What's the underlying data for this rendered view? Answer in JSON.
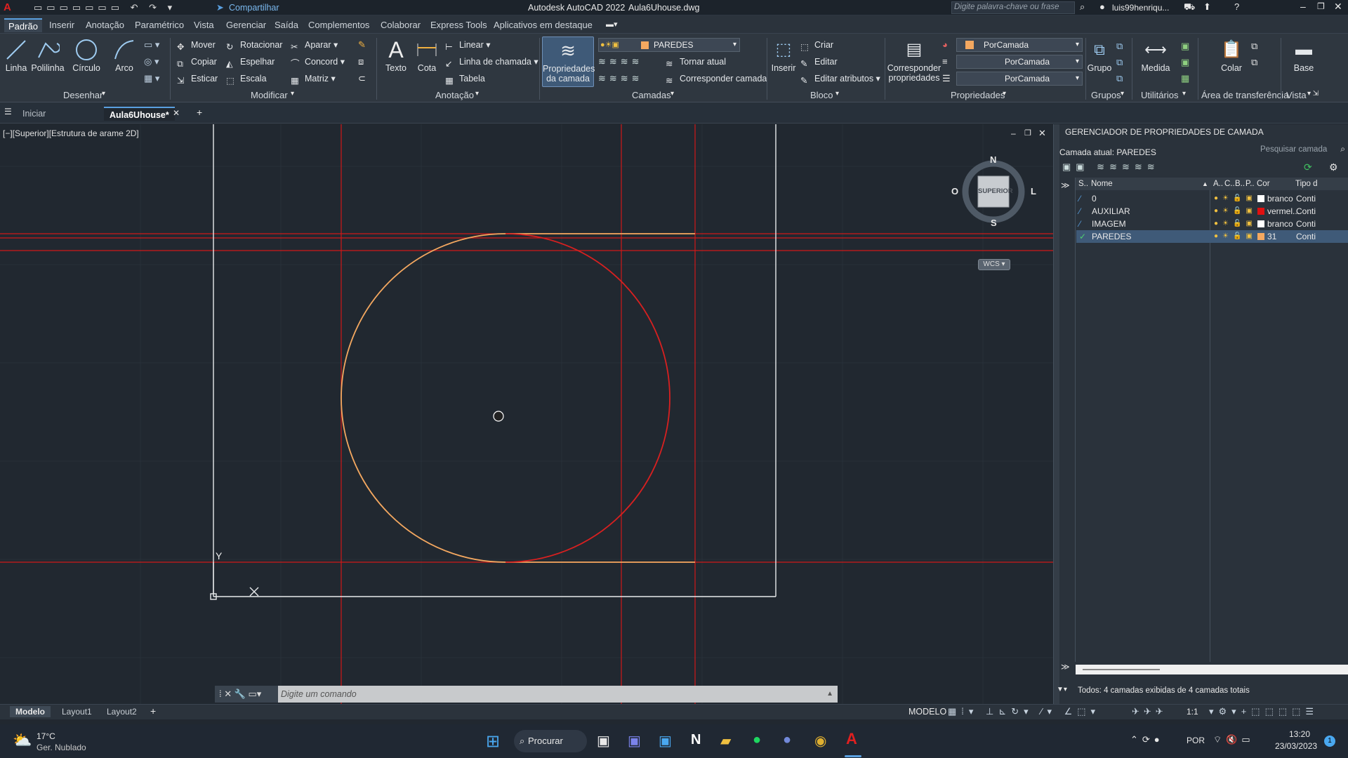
{
  "titlebar": {
    "app_title": "Autodesk AutoCAD 2022",
    "file_name": "Aula6Uhouse.dwg",
    "share_label": "Compartilhar",
    "search_placeholder": "Digite palavra-chave ou frase",
    "user": "luis99henriqu..."
  },
  "ribbon_tabs": [
    "Padrão",
    "Inserir",
    "Anotação",
    "Paramétrico",
    "Vista",
    "Gerenciar",
    "Saída",
    "Complementos",
    "Colaborar",
    "Express Tools",
    "Aplicativos em destaque"
  ],
  "ribbon": {
    "draw": {
      "title": "Desenhar",
      "linha": "Linha",
      "polilinha": "Polilinha",
      "circulo": "Círculo",
      "arco": "Arco"
    },
    "modify": {
      "title": "Modificar",
      "mover": "Mover",
      "rotacionar": "Rotacionar",
      "aparar": "Aparar",
      "copiar": "Copiar",
      "espelhar": "Espelhar",
      "concord": "Concord",
      "esticar": "Esticar",
      "escala": "Escala",
      "matriz": "Matriz"
    },
    "annotation": {
      "title": "Anotação",
      "texto": "Texto",
      "cota": "Cota",
      "linear": "Linear",
      "linha_chamada": "Linha de chamada",
      "tabela": "Tabela"
    },
    "layers": {
      "title": "Camadas",
      "props_line1": "Propriedades",
      "props_line2": "da camada",
      "current_layer": "PAREDES",
      "tornar_atual": "Tornar atual",
      "corresponder_camada": "Corresponder camada"
    },
    "block": {
      "title": "Bloco",
      "inserir": "Inserir",
      "criar": "Criar",
      "editar": "Editar",
      "editar_atributos": "Editar atributos"
    },
    "properties": {
      "title": "Propriedades",
      "corresp_line1": "Corresponder",
      "corresp_line2": "propriedades",
      "color": "PorCamada",
      "linetype": "PorCamada",
      "lineweight": "PorCamada"
    },
    "groups": {
      "title": "Grupos",
      "grupo": "Grupo"
    },
    "utilities": {
      "title": "Utilitários",
      "medida": "Medida"
    },
    "clipboard": {
      "title": "Área de transferência",
      "colar": "Colar"
    },
    "view": {
      "title": "Vista",
      "base": "Base"
    }
  },
  "doc_tabs": {
    "start": "Iniciar",
    "active": "Aula6Uhouse*"
  },
  "viewport": {
    "label": "[−][Superior][Estrutura de arame 2D]",
    "viewcube": {
      "n": "N",
      "s": "S",
      "o": "O",
      "l": "L",
      "face": "SUPERIOR",
      "wcs": "WCS"
    },
    "ucs_y": "Y"
  },
  "command": {
    "placeholder": "Digite um comando"
  },
  "layer_manager": {
    "title": "GERENCIADOR DE PROPRIEDADES DE CAMADA",
    "current": "Camada atual: PAREDES",
    "search": "Pesquisar camada",
    "columns": {
      "s": "S..",
      "nome": "Nome",
      "a": "A..",
      "c": "C..",
      "b": "B..",
      "p": "P..",
      "cor": "Cor",
      "tipo": "Tipo d"
    },
    "layers": [
      {
        "name": "0",
        "color_name": "branco",
        "color": "#ffffff",
        "linetype": "Conti"
      },
      {
        "name": "AUXILIAR",
        "color_name": "vermel...",
        "color": "#e01010",
        "linetype": "Conti"
      },
      {
        "name": "IMAGEM",
        "color_name": "branco",
        "color": "#ffffff",
        "linetype": "Conti"
      },
      {
        "name": "PAREDES",
        "color_name": "31",
        "color": "#f4a860",
        "linetype": "Conti"
      }
    ],
    "footer": "Todos: 4 camadas exibidas de 4 camadas totais"
  },
  "layout_tabs": [
    "Modelo",
    "Layout1",
    "Layout2"
  ],
  "status": {
    "modelo": "MODELO",
    "scale": "1:1"
  },
  "taskbar": {
    "weather_temp": "17°C",
    "weather_desc": "Ger. Nublado",
    "search": "Procurar",
    "lang": "POR",
    "time": "13:20",
    "date": "23/03/2023",
    "notif": "1"
  },
  "colors": {
    "accent": "#5aa0e0",
    "wall": "#f4a860",
    "aux": "#e01010",
    "bg": "#212830"
  }
}
